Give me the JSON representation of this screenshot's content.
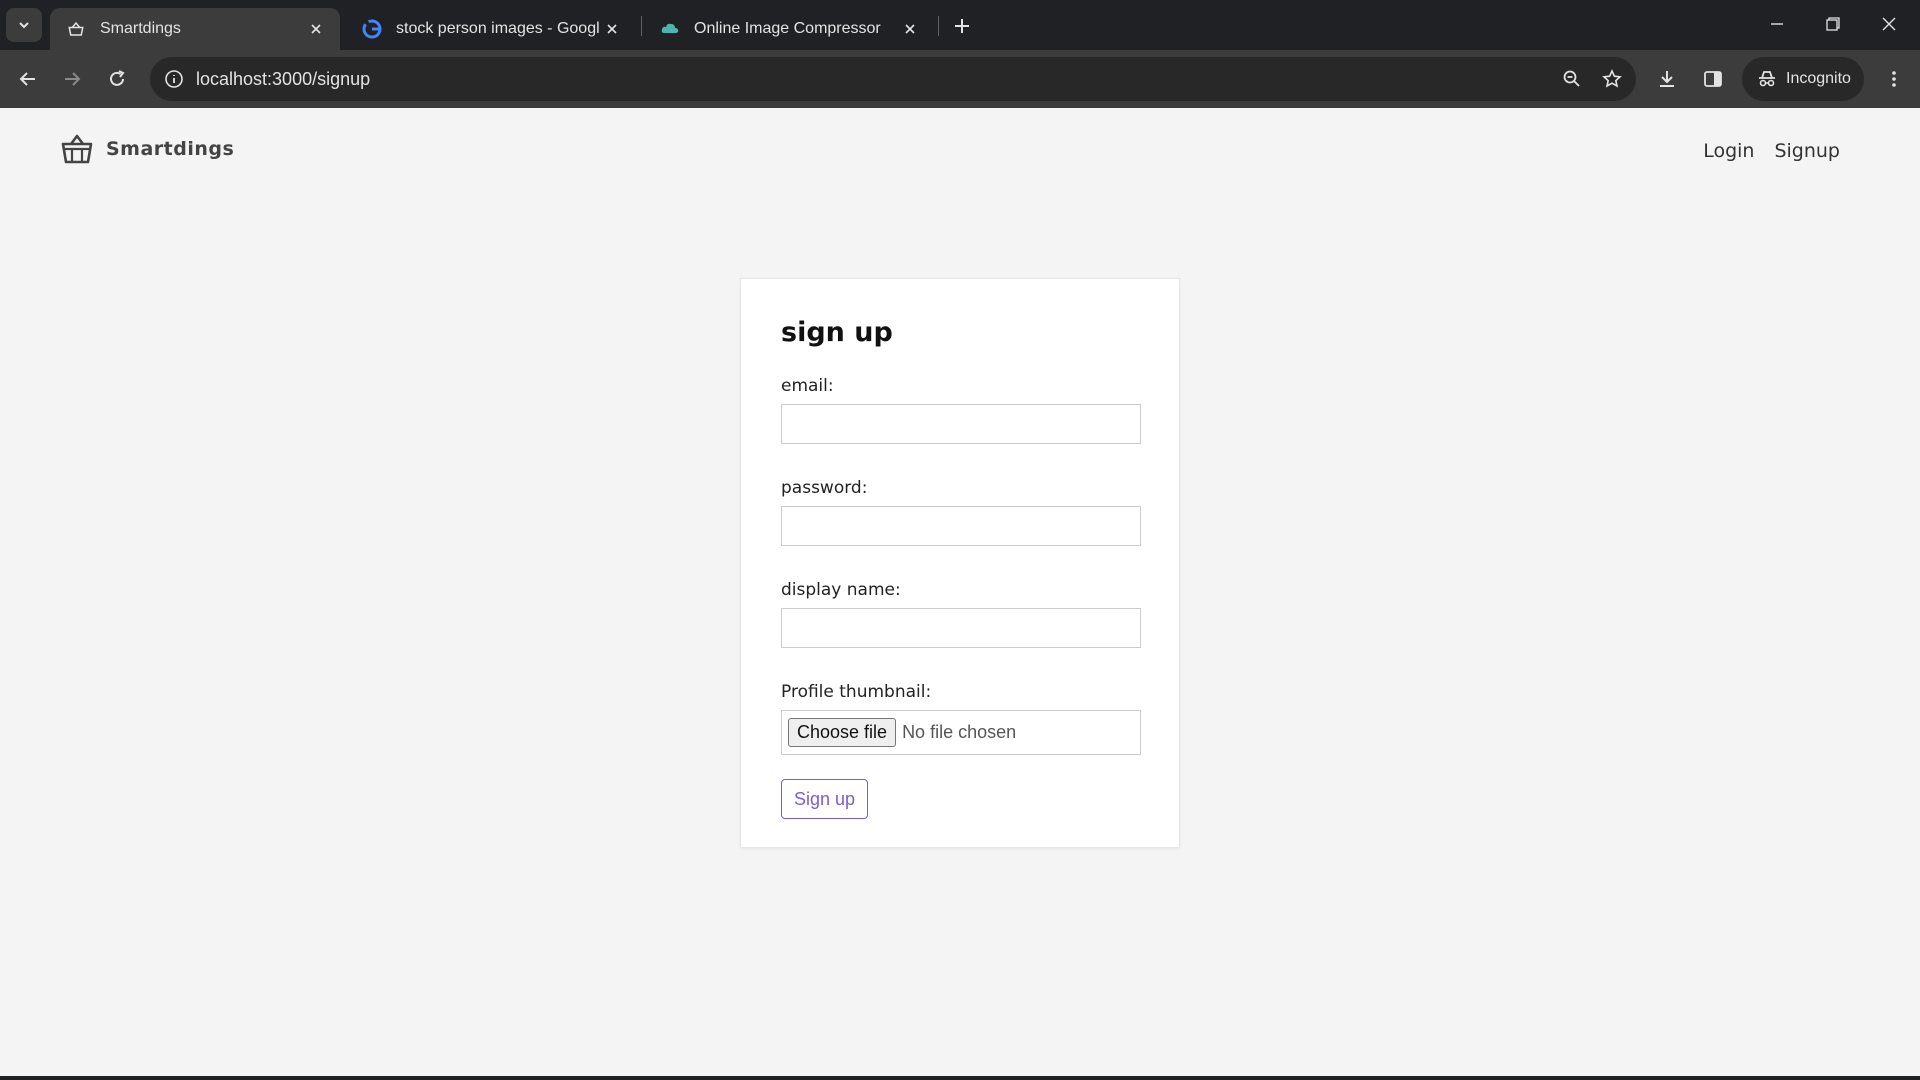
{
  "browser": {
    "tabs": [
      {
        "title": "Smartdings",
        "active": true
      },
      {
        "title": "stock person images - Google Search",
        "active": false
      },
      {
        "title": "Online Image Compressor",
        "active": false
      }
    ],
    "url": "localhost:3000/signup",
    "incognito_label": "Incognito"
  },
  "site": {
    "brand": "Smartdings",
    "nav": {
      "login": "Login",
      "signup": "Signup"
    }
  },
  "form": {
    "title": "sign up",
    "email_label": "email:",
    "email_value": "",
    "password_label": "password:",
    "password_value": "",
    "display_name_label": "display name:",
    "display_name_value": "",
    "thumbnail_label": "Profile thumbnail:",
    "choose_file_label": "Choose file",
    "file_status": "No file chosen",
    "submit_label": "Sign up"
  },
  "colors": {
    "accent": "#7b5cd6",
    "page_background": "#f4f4f4",
    "chrome_dark": "#202124"
  }
}
